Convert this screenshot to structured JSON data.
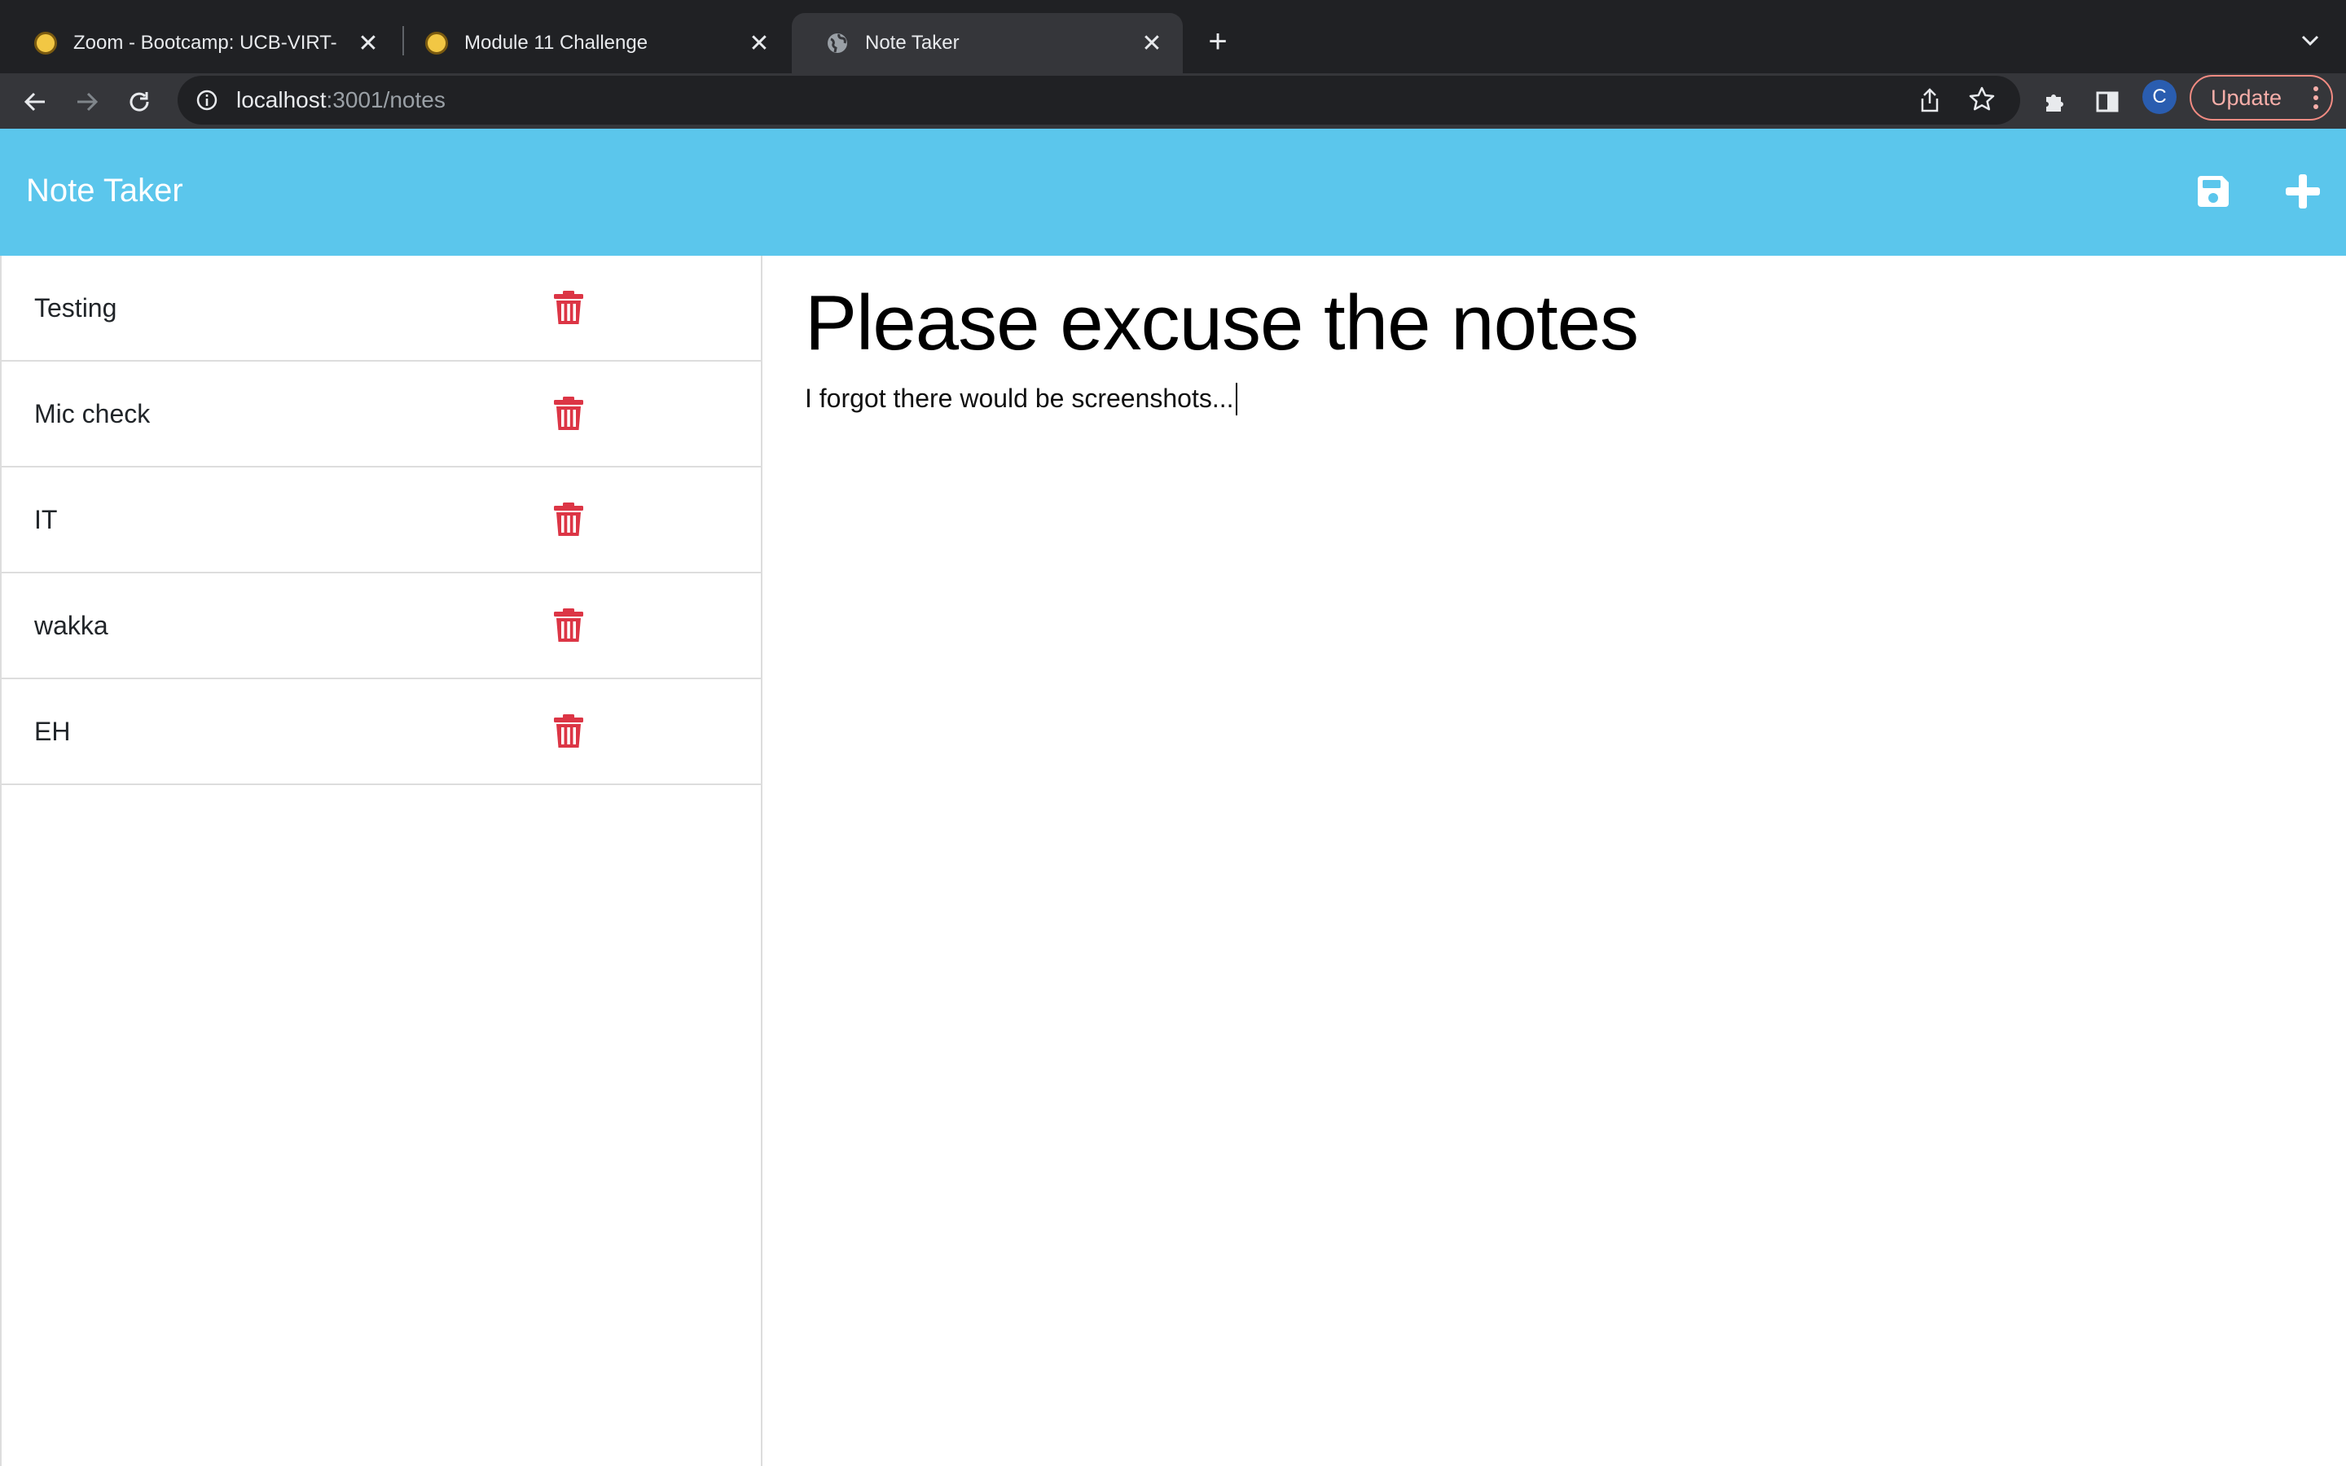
{
  "browser": {
    "tabs": [
      {
        "title": "Zoom - Bootcamp: UCB-VIRT-",
        "icon": "zoom-favicon"
      },
      {
        "title": "Module 11 Challenge",
        "icon": "zoom-favicon"
      },
      {
        "title": "Note Taker",
        "icon": "globe-icon",
        "active": true
      }
    ],
    "url_host": "localhost",
    "url_rest": ":3001/notes",
    "profile_initial": "C",
    "update_label": "Update"
  },
  "app": {
    "brand": "Note Taker",
    "accent_color": "#5bc6ec",
    "delete_color": "#dc3545",
    "notes": [
      {
        "title": "Testing"
      },
      {
        "title": "Mic check"
      },
      {
        "title": "IT"
      },
      {
        "title": "wakka"
      },
      {
        "title": "EH"
      }
    ],
    "active_note": {
      "title": "Please excuse the notes",
      "text": "I forgot there would be screenshots..."
    }
  }
}
